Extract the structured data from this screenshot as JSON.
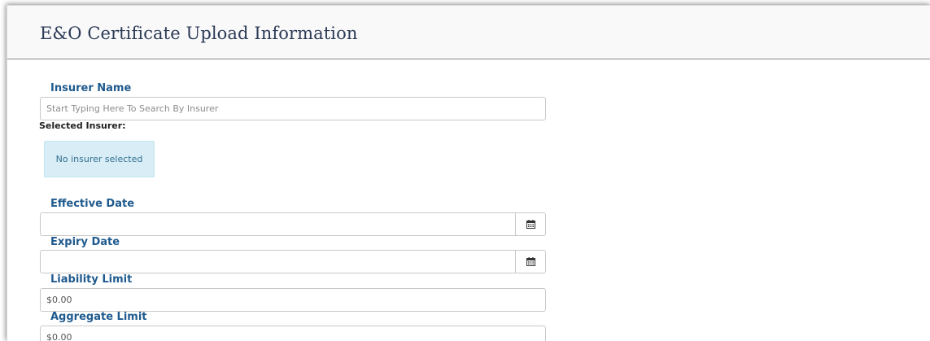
{
  "panel": {
    "title": "E&O Certificate Upload Information"
  },
  "form": {
    "insurer_name": {
      "label": "Insurer Name",
      "placeholder": "Start Typing Here To Search By Insurer",
      "value": ""
    },
    "selected_insurer": {
      "label": "Selected Insurer:",
      "status": "No insurer selected"
    },
    "effective_date": {
      "label": "Effective Date",
      "value": "",
      "icon": "calendar-icon"
    },
    "expiry_date": {
      "label": "Expiry Date",
      "value": "",
      "icon": "calendar-icon"
    },
    "liability_limit": {
      "label": "Liability Limit",
      "value": "$0.00"
    },
    "aggregate_limit": {
      "label": "Aggregate Limit",
      "value": "$0.00"
    }
  },
  "colors": {
    "label": "#1f5a8e",
    "title": "#2b3a56",
    "alert_bg": "#d9edf7",
    "alert_text": "#31708f"
  }
}
